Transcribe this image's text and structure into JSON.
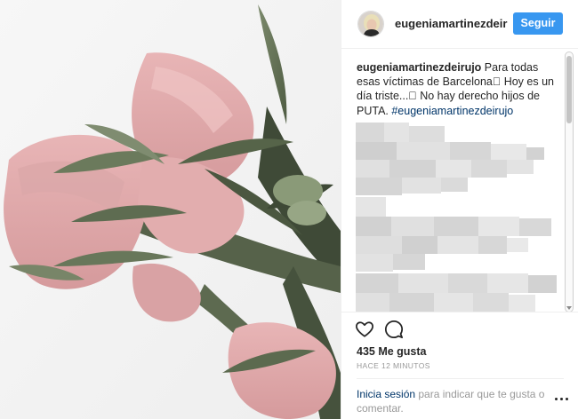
{
  "post": {
    "username": "eugeniamartinezdeir",
    "follow_label": "Seguir",
    "caption": {
      "author": "eugeniamartinezdeirujo",
      "text": " Para todas esas víctimas de Barcelona🏻 Hoy es un día triste...🏻 No hay derecho hijos de PUTA. ",
      "hashtag": "#eugeniamartinezdeirujo"
    },
    "likes": "435 Me gusta",
    "time": "HACE 12 MINUTOS",
    "login_link": "Inicia sesión",
    "login_rest": " para indicar que te gusta o comentar."
  },
  "icons": {
    "like": "heart-outline-icon",
    "comment": "speech-bubble-icon",
    "more": "ellipsis-icon"
  },
  "colors": {
    "follow_button": "#3897f0",
    "link": "#003569",
    "muted": "#999999"
  }
}
